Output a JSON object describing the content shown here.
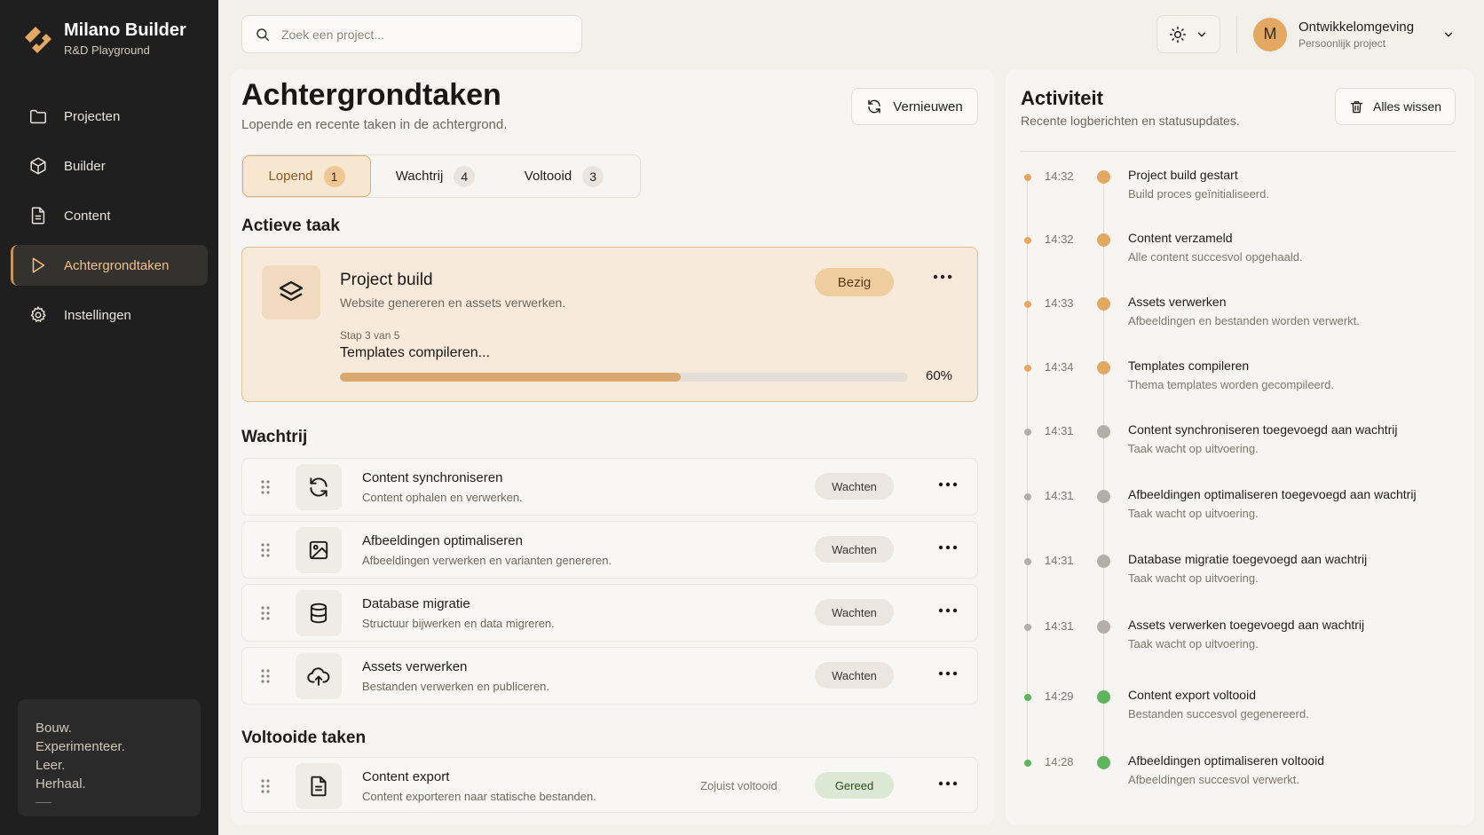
{
  "colors": {
    "accent": "#d9a86c",
    "sidebar": "#1f1f1f",
    "active": "#e3a862",
    "queued": "#b3afa8",
    "done": "#5eb55e"
  },
  "brand": {
    "title": "Milano Builder",
    "subtitle": "R&D Playground"
  },
  "nav": [
    {
      "label": "Projecten",
      "icon": "folder-icon"
    },
    {
      "label": "Builder",
      "icon": "cube-icon"
    },
    {
      "label": "Content",
      "icon": "document-icon"
    },
    {
      "label": "Achtergrondtaken",
      "icon": "play-icon",
      "active": true
    },
    {
      "label": "Instellingen",
      "icon": "gear-icon"
    }
  ],
  "motto": [
    "Bouw.",
    "Experimenteer.",
    "Leer.",
    "Herhaal."
  ],
  "search": {
    "placeholder": "Zoek een project..."
  },
  "profile": {
    "initial": "M",
    "name": "Ontwikkelomgeving",
    "sub": "Persoonlijk project"
  },
  "page": {
    "title": "Achtergrondtaken",
    "subtitle": "Lopende en recente taken in de achtergrond.",
    "refresh": "Vernieuwen"
  },
  "tabs": [
    {
      "label": "Lopend",
      "count": "1",
      "active": true
    },
    {
      "label": "Wachtrij",
      "count": "4"
    },
    {
      "label": "Voltooid",
      "count": "3"
    }
  ],
  "sections": {
    "active": "Actieve taak",
    "queue": "Wachtrij",
    "done": "Voltooide taken"
  },
  "active_task": {
    "title": "Project build",
    "subtitle": "Website genereren en assets verwerken.",
    "badge": "Bezig",
    "step": "Stap 3 van 5",
    "step_name": "Templates compileren...",
    "progress": 0.6,
    "progress_label": "60%"
  },
  "queue": [
    {
      "title": "Content synchroniseren",
      "subtitle": "Content ophalen en verwerken.",
      "status": "Wachten",
      "icon": "sync-icon"
    },
    {
      "title": "Afbeeldingen optimaliseren",
      "subtitle": "Afbeeldingen verwerken en varianten genereren.",
      "status": "Wachten",
      "icon": "image-icon"
    },
    {
      "title": "Database migratie",
      "subtitle": "Structuur bijwerken en data migreren.",
      "status": "Wachten",
      "icon": "database-icon"
    },
    {
      "title": "Assets verwerken",
      "subtitle": "Bestanden verwerken en publiceren.",
      "status": "Wachten",
      "icon": "cloud-upload-icon"
    }
  ],
  "completed": [
    {
      "title": "Content export",
      "subtitle": "Content exporteren naar statische bestanden.",
      "meta": "Zojuist voltooid",
      "status": "Gereed",
      "icon": "document-icon"
    }
  ],
  "activity": {
    "title": "Activiteit",
    "subtitle": "Recente logberichten en statusupdates.",
    "clear": "Alles wissen",
    "items": [
      {
        "time": "14:32",
        "title": "Project build gestart",
        "sub": "Build proces geïnitialiseerd.",
        "kind": "active"
      },
      {
        "time": "14:32",
        "title": "Content verzameld",
        "sub": "Alle content succesvol opgehaald.",
        "kind": "active"
      },
      {
        "time": "14:33",
        "title": "Assets verwerken",
        "sub": "Afbeeldingen en bestanden worden verwerkt.",
        "kind": "active"
      },
      {
        "time": "14:34",
        "title": "Templates compileren",
        "sub": "Thema templates worden gecompileerd.",
        "kind": "active"
      },
      {
        "time": "14:31",
        "title": "Content synchroniseren toegevoegd aan wachtrij",
        "sub": "Taak wacht op uitvoering.",
        "kind": "queued"
      },
      {
        "time": "14:31",
        "title": "Afbeeldingen optimaliseren toegevoegd aan wachtrij",
        "sub": "Taak wacht op uitvoering.",
        "kind": "queued"
      },
      {
        "time": "14:31",
        "title": "Database migratie toegevoegd aan wachtrij",
        "sub": "Taak wacht op uitvoering.",
        "kind": "queued"
      },
      {
        "time": "14:31",
        "title": "Assets verwerken toegevoegd aan wachtrij",
        "sub": "Taak wacht op uitvoering.",
        "kind": "queued"
      },
      {
        "time": "14:29",
        "title": "Content export voltooid",
        "sub": "Bestanden succesvol gegenereerd.",
        "kind": "done"
      },
      {
        "time": "14:28",
        "title": "Afbeeldingen optimaliseren voltooid",
        "sub": "Afbeeldingen succesvol verwerkt.",
        "kind": "done"
      }
    ]
  }
}
